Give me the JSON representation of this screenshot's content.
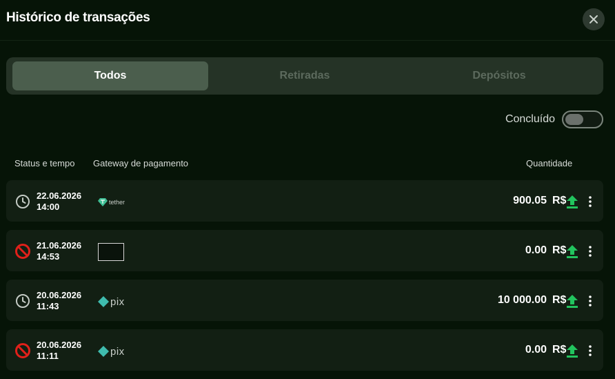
{
  "header": {
    "title": "Histórico de transações",
    "close_icon": "close-icon"
  },
  "tabs": [
    {
      "label": "Todos",
      "active": true
    },
    {
      "label": "Retiradas",
      "active": false
    },
    {
      "label": "Depósitos",
      "active": false
    }
  ],
  "filter": {
    "label": "Concluído",
    "enabled": false
  },
  "columns": {
    "status": "Status e tempo",
    "gateway": "Gateway de pagamento",
    "amount": "Quantidade"
  },
  "transactions": [
    {
      "status": "pending",
      "status_icon": "clock-icon",
      "date": "22.06.2026",
      "time": "14:00",
      "gateway": "tether",
      "gateway_text": "tether",
      "amount": "900.05",
      "currency": "R$",
      "direction_icon": "upload-arrow-icon"
    },
    {
      "status": "cancelled",
      "status_icon": "cancel-icon",
      "date": "21.06.2026",
      "time": "14:53",
      "gateway": "broken-image",
      "amount": "0.00",
      "currency": "R$",
      "direction_icon": "upload-arrow-icon"
    },
    {
      "status": "pending",
      "status_icon": "clock-icon",
      "date": "20.06.2026",
      "time": "11:43",
      "gateway": "pix",
      "gateway_text": "pix",
      "amount": "10 000.00",
      "currency": "R$",
      "direction_icon": "upload-arrow-icon"
    },
    {
      "status": "cancelled",
      "status_icon": "cancel-icon",
      "date": "20.06.2026",
      "time": "11:11",
      "gateway": "pix",
      "gateway_text": "pix",
      "amount": "0.00",
      "currency": "R$",
      "direction_icon": "upload-arrow-icon"
    }
  ],
  "colors": {
    "background": "#061407",
    "accent_green": "#22c45e",
    "cancel_red": "#e0201a",
    "row_bg": "#121f13"
  }
}
